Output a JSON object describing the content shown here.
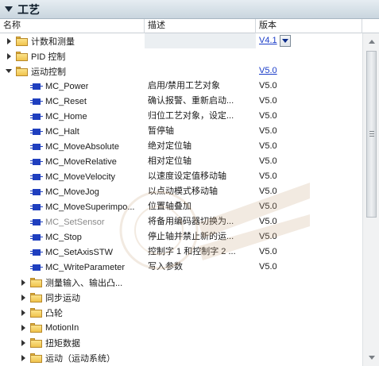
{
  "panel": {
    "title": "工艺"
  },
  "columns": {
    "name": "名称",
    "description": "描述",
    "version": "版本"
  },
  "rows": [
    {
      "indent": 0,
      "toggle": "collapsed",
      "icon": "folder-icon",
      "name": "计数和测量",
      "description": "",
      "version": "V4.1",
      "version_link": true,
      "version_dropdown": true,
      "selected": true
    },
    {
      "indent": 0,
      "toggle": "collapsed",
      "icon": "folder-icon",
      "name": "PID 控制",
      "description": "",
      "version": "",
      "version_link": false
    },
    {
      "indent": 0,
      "toggle": "expanded",
      "icon": "folder-icon",
      "name": "运动控制",
      "description": "",
      "version": "V5.0",
      "version_link": true
    },
    {
      "indent": 2,
      "toggle": "none",
      "icon": "instruction-icon",
      "name": "MC_Power",
      "description": "启用/禁用工艺对象",
      "version": "V5.0"
    },
    {
      "indent": 2,
      "toggle": "none",
      "icon": "instruction-icon",
      "name": "MC_Reset",
      "description": "确认报警、重新启动...",
      "version": "V5.0"
    },
    {
      "indent": 2,
      "toggle": "none",
      "icon": "instruction-icon",
      "name": "MC_Home",
      "description": "归位工艺对象，设定...",
      "version": "V5.0"
    },
    {
      "indent": 2,
      "toggle": "none",
      "icon": "instruction-icon",
      "name": "MC_Halt",
      "description": "暂停轴",
      "version": "V5.0"
    },
    {
      "indent": 2,
      "toggle": "none",
      "icon": "instruction-icon",
      "name": "MC_MoveAbsolute",
      "description": "绝对定位轴",
      "version": "V5.0"
    },
    {
      "indent": 2,
      "toggle": "none",
      "icon": "instruction-icon",
      "name": "MC_MoveRelative",
      "description": "相对定位轴",
      "version": "V5.0"
    },
    {
      "indent": 2,
      "toggle": "none",
      "icon": "instruction-icon",
      "name": "MC_MoveVelocity",
      "description": "以速度设定值移动轴",
      "version": "V5.0"
    },
    {
      "indent": 2,
      "toggle": "none",
      "icon": "instruction-icon",
      "name": "MC_MoveJog",
      "description": "以点动模式移动轴",
      "version": "V5.0"
    },
    {
      "indent": 2,
      "toggle": "none",
      "icon": "instruction-icon",
      "name": "MC_MoveSuperimpo...",
      "description": "位置轴叠加",
      "version": "V5.0"
    },
    {
      "indent": 2,
      "toggle": "none",
      "icon": "instruction-icon",
      "name": "MC_SetSensor",
      "description": "将备用编码器切换为...",
      "version": "V5.0",
      "disabled": true
    },
    {
      "indent": 2,
      "toggle": "none",
      "icon": "instruction-icon",
      "name": "MC_Stop",
      "description": "停止轴并禁止新的运...",
      "version": "V5.0"
    },
    {
      "indent": 2,
      "toggle": "none",
      "icon": "instruction-icon",
      "name": "MC_SetAxisSTW",
      "description": "控制字 1 和控制字 2 ...",
      "version": "V5.0"
    },
    {
      "indent": 2,
      "toggle": "none",
      "icon": "instruction-icon",
      "name": "MC_WriteParameter",
      "description": "写入参数",
      "version": "V5.0"
    },
    {
      "indent": 1,
      "toggle": "collapsed",
      "icon": "folder-icon",
      "name": "测量输入、输出凸...",
      "description": "",
      "version": ""
    },
    {
      "indent": 1,
      "toggle": "collapsed",
      "icon": "folder-icon",
      "name": "同步运动",
      "description": "",
      "version": ""
    },
    {
      "indent": 1,
      "toggle": "collapsed",
      "icon": "folder-icon",
      "name": "凸轮",
      "description": "",
      "version": ""
    },
    {
      "indent": 1,
      "toggle": "collapsed",
      "icon": "folder-icon",
      "name": "MotionIn",
      "description": "",
      "version": ""
    },
    {
      "indent": 1,
      "toggle": "collapsed",
      "icon": "folder-icon",
      "name": "扭矩数据",
      "description": "",
      "version": ""
    },
    {
      "indent": 1,
      "toggle": "collapsed",
      "icon": "folder-icon",
      "name": "运动（运动系统）",
      "description": "",
      "version": ""
    }
  ],
  "colors": {
    "link": "#1a3cc8",
    "instruction_icon": "#1f3fbf",
    "folder": "#f0c34d",
    "header_bg": "#c9d5de"
  }
}
